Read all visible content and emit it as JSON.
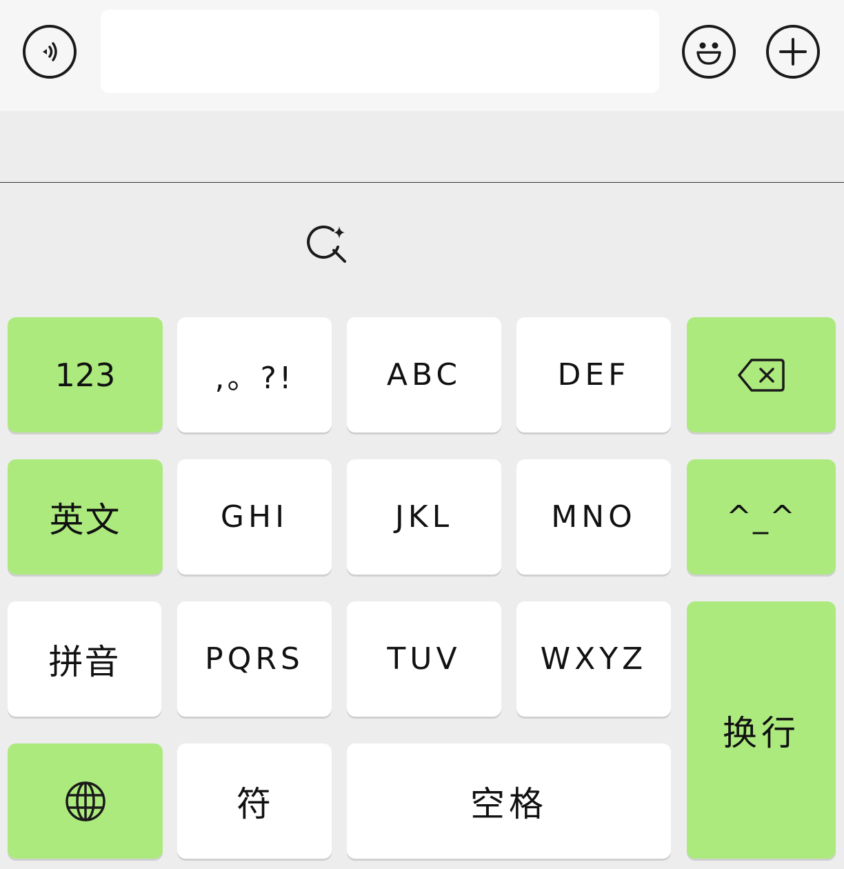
{
  "toolbar": {
    "voice_icon": "voice-icon",
    "input_value": "",
    "emoji_icon": "emoji-icon",
    "add_icon": "plus-icon"
  },
  "keyboard": {
    "ai_search_icon": "sparkle-search-icon",
    "keys": {
      "num": "123",
      "punct": ",。?!",
      "abc": "ABC",
      "def": "DEF",
      "backspace_icon": "backspace-icon",
      "english": "英文",
      "ghi": "GHI",
      "jkl": "JKL",
      "mno": "MNO",
      "emoticon": "^_^",
      "pinyin": "拼音",
      "pqrs": "PQRS",
      "tuv": "TUV",
      "wxyz": "WXYZ",
      "newline": "换行",
      "globe_icon": "globe-icon",
      "symbol": "符",
      "space": "空格"
    }
  },
  "colors": {
    "function_key": "#acea7e",
    "letter_key": "#ffffff",
    "keyboard_bg": "#ededed",
    "toolbar_bg": "#f6f6f6"
  }
}
